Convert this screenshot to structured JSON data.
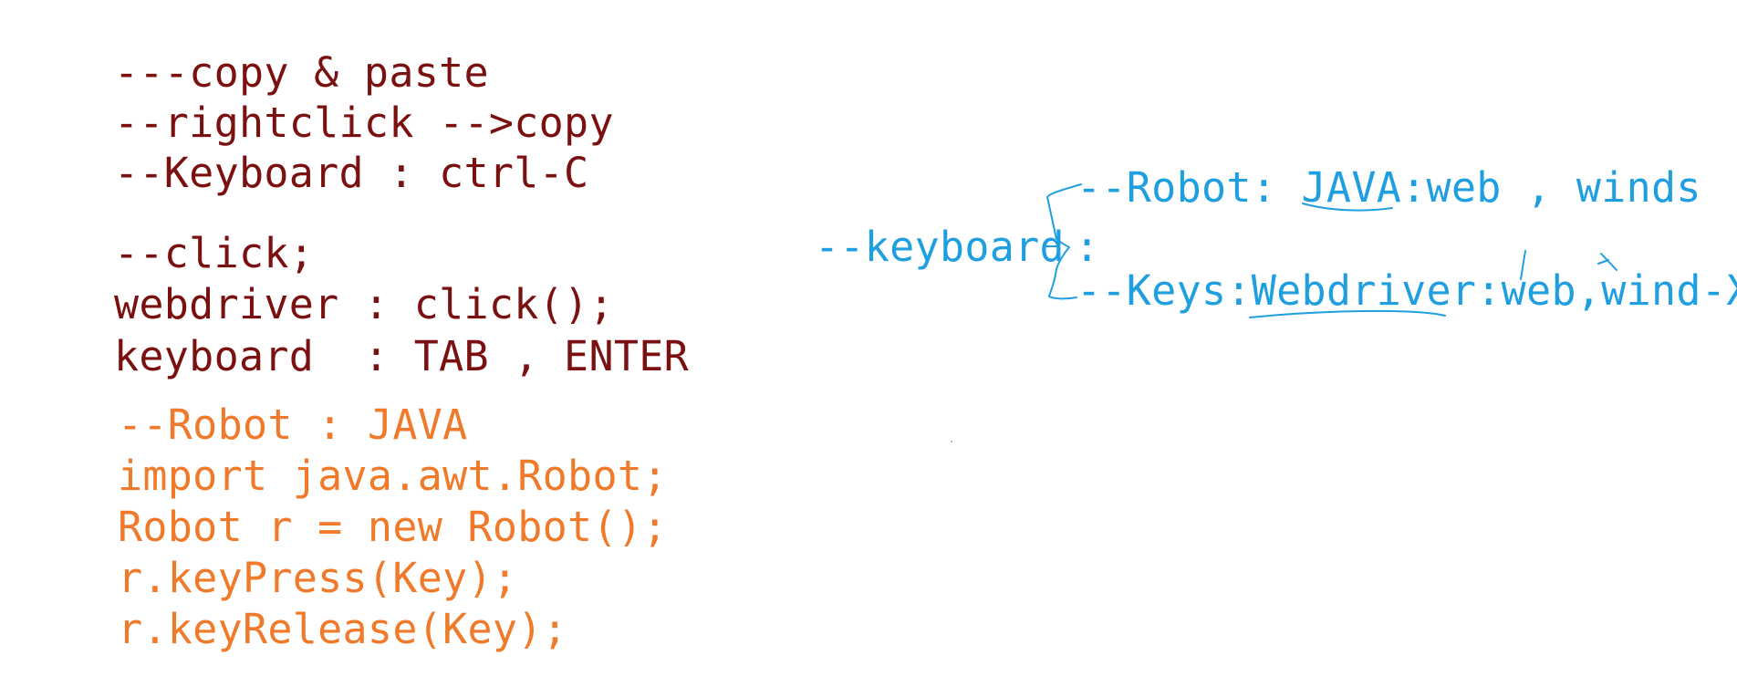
{
  "notes": {
    "left": {
      "dark_lines": [
        "---copy & paste",
        "--rightclick -->copy",
        "--Keyboard : ctrl-C",
        "--click;",
        "webdriver : click();",
        "keyboard  : TAB , ENTER"
      ],
      "orange_lines": [
        "--Robot : JAVA",
        "import java.awt.Robot;",
        "Robot r = new Robot();",
        "r.keyPress(Key);",
        "r.keyRelease(Key);"
      ]
    },
    "right": {
      "root": "--keyboard",
      "colon": ":",
      "branches": [
        "--Robot: JAVA:web , winds",
        "--Keys:Webdriver:web,wind-X"
      ]
    }
  },
  "colors": {
    "dark_red": "#7b1010",
    "orange": "#f07a2a",
    "blue": "#1f9fe0"
  }
}
